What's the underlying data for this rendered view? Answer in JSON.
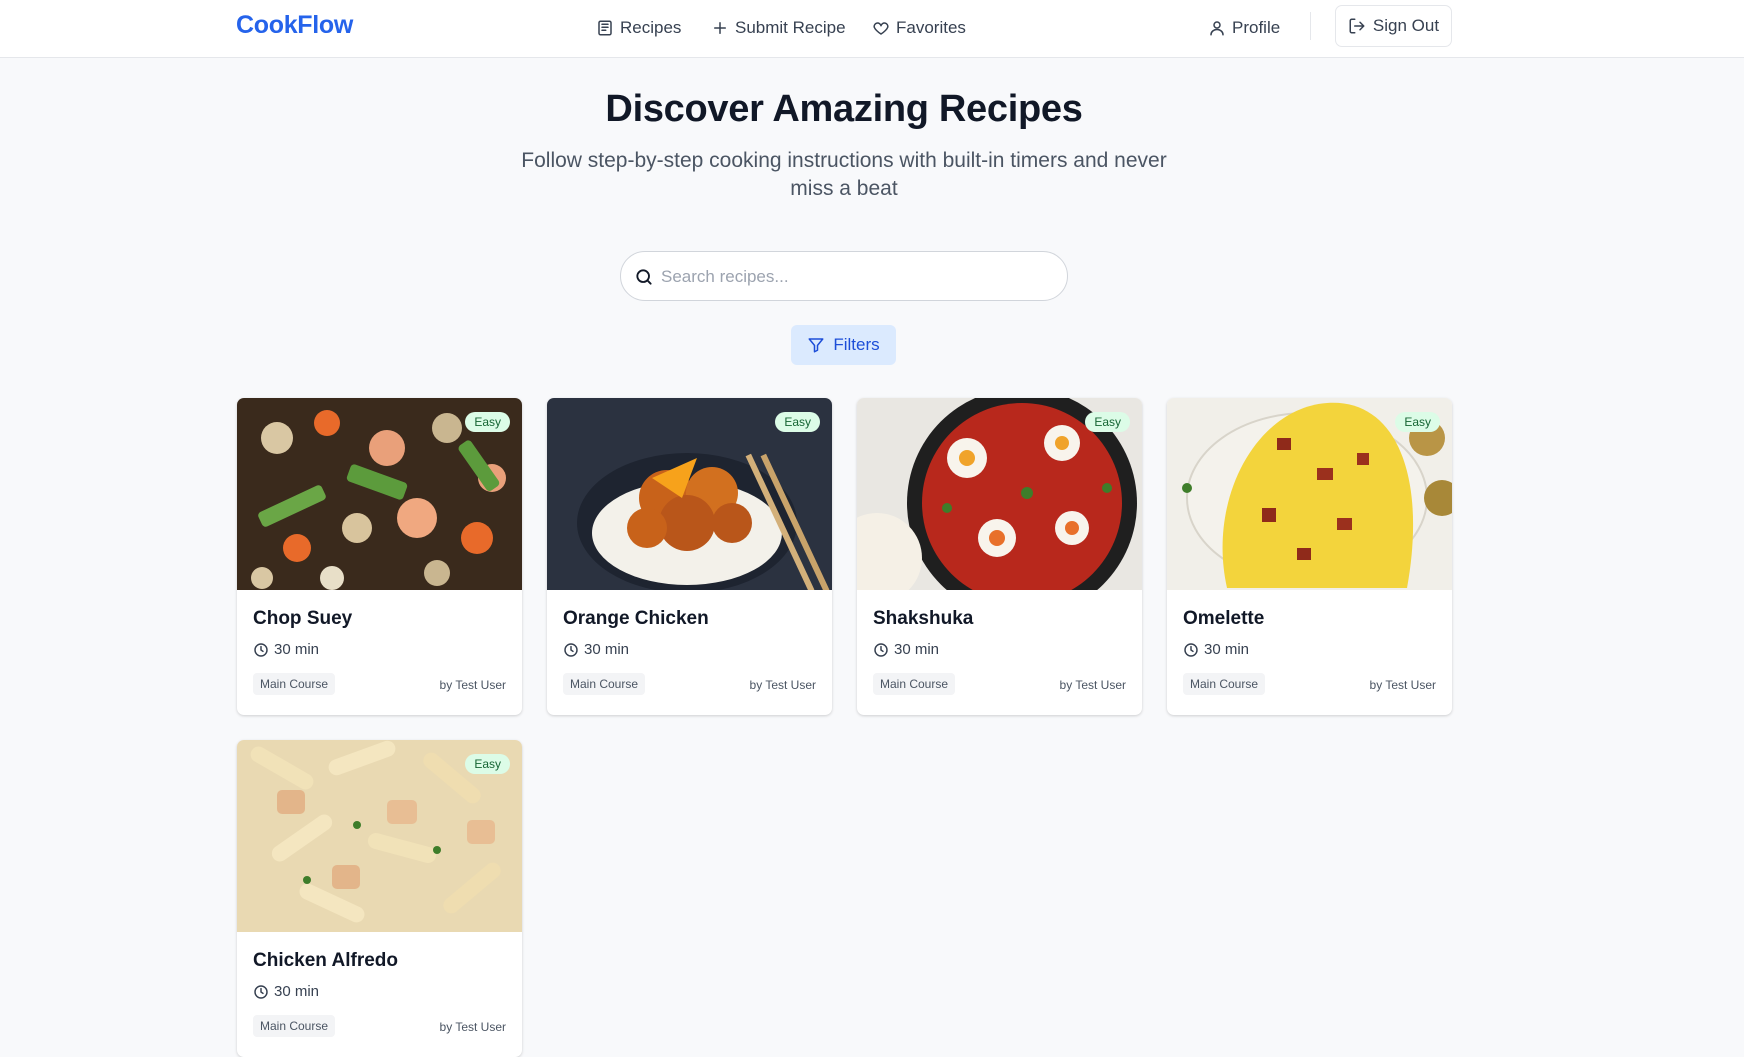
{
  "nav": {
    "brand": "CookFlow",
    "links": [
      {
        "label": "Recipes",
        "icon": "book-icon"
      },
      {
        "label": "Submit Recipe",
        "icon": "plus-icon"
      },
      {
        "label": "Favorites",
        "icon": "heart-icon"
      }
    ],
    "profile_label": "Profile",
    "signout_label": "Sign Out"
  },
  "hero": {
    "title": "Discover Amazing Recipes",
    "subtitle": "Follow step-by-step cooking instructions with built-in timers and never miss a beat"
  },
  "search": {
    "placeholder": "Search recipes...",
    "value": ""
  },
  "filters_label": "Filters",
  "colors": {
    "brand": "#2563eb",
    "badge_bg": "#dcfce7",
    "badge_text": "#166534",
    "filter_bg": "#dbeafe"
  },
  "recipes": [
    {
      "title": "Chop Suey",
      "difficulty": "Easy",
      "time": "30 min",
      "category": "Main Course",
      "author": "by Test User"
    },
    {
      "title": "Orange Chicken",
      "difficulty": "Easy",
      "time": "30 min",
      "category": "Main Course",
      "author": "by Test User"
    },
    {
      "title": "Shakshuka",
      "difficulty": "Easy",
      "time": "30 min",
      "category": "Main Course",
      "author": "by Test User"
    },
    {
      "title": "Omelette",
      "difficulty": "Easy",
      "time": "30 min",
      "category": "Main Course",
      "author": "by Test User"
    },
    {
      "title": "Chicken Alfredo",
      "difficulty": "Easy",
      "time": "30 min",
      "category": "Main Course",
      "author": "by Test User"
    }
  ]
}
